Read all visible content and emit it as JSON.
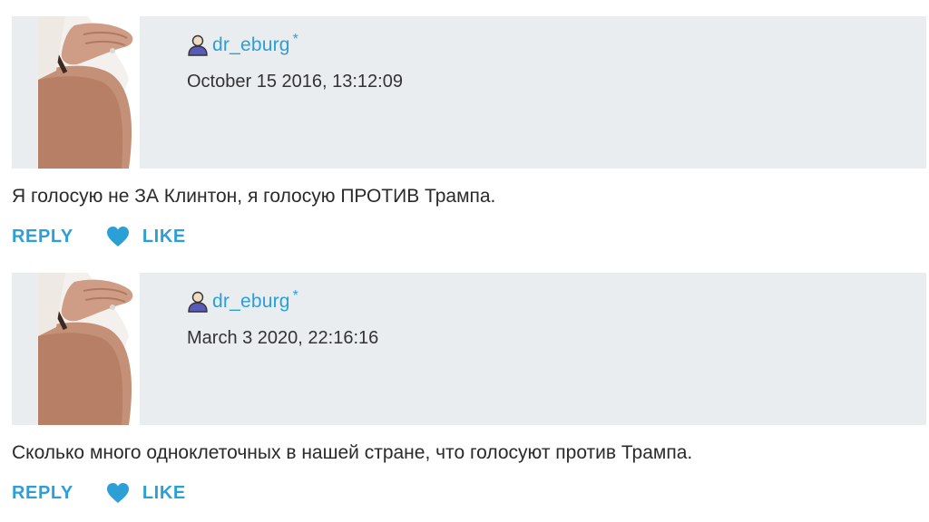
{
  "comments": [
    {
      "author": "dr_eburg",
      "author_marker": "*",
      "timestamp": "October 15 2016, 13:12:09",
      "text": "Я голосую не ЗА Клинтон, я голосую ПРОТИВ Трампа.",
      "reply_label": "REPLY",
      "like_label": "LIKE"
    },
    {
      "author": "dr_eburg",
      "author_marker": "*",
      "timestamp": "March 3 2020, 22:16:16",
      "text": "Сколько много одноклеточных в нашей стране, что голосуют против Трампа.",
      "reply_label": "REPLY",
      "like_label": "LIKE"
    }
  ],
  "icons": {
    "user": "user-icon",
    "like": "heart-icon"
  },
  "colors": {
    "accent": "#2b9fd6",
    "header_bg": "#e9edf0",
    "text": "#2a2a2a"
  }
}
